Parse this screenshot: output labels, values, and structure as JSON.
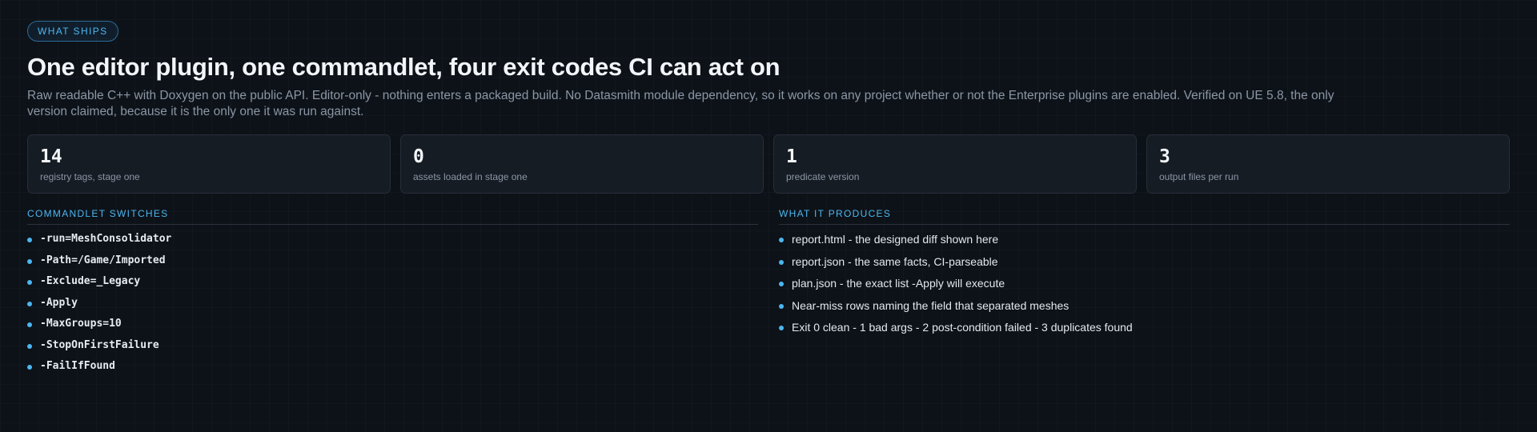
{
  "header": {
    "eyebrow": "WHAT SHIPS",
    "title": "One editor plugin, one commandlet, four exit codes CI can act on",
    "description": "Raw readable C++ with Doxygen on the public API. Editor-only - nothing enters a packaged build. No Datasmith module dependency, so it works on any project whether or not the Enterprise plugins are enabled. Verified on UE 5.8, the only version claimed, because it is the only one it was run against."
  },
  "stats": [
    {
      "value": "14",
      "label": "registry tags, stage one"
    },
    {
      "value": "0",
      "label": "assets loaded in stage one"
    },
    {
      "value": "1",
      "label": "predicate version"
    },
    {
      "value": "3",
      "label": "output files per run"
    }
  ],
  "switches": {
    "title": "COMMANDLET SWITCHES",
    "items": [
      "-run=MeshConsolidator",
      "-Path=/Game/Imported",
      "-Exclude=_Legacy",
      "-Apply",
      "-MaxGroups=10",
      "-StopOnFirstFailure",
      "-FailIfFound"
    ]
  },
  "produces": {
    "title": "WHAT IT PRODUCES",
    "items": [
      "report.html - the designed diff shown here",
      "report.json - the same facts, CI-parseable",
      "plan.json - the exact list -Apply will execute",
      "Near-miss rows naming the field that separated meshes",
      "Exit 0 clean - 1 bad args - 2 post-condition failed - 3 duplicates found"
    ]
  },
  "colors": {
    "accent": "#4cb6f0",
    "background": "#0d1218",
    "card": "#161c24"
  }
}
